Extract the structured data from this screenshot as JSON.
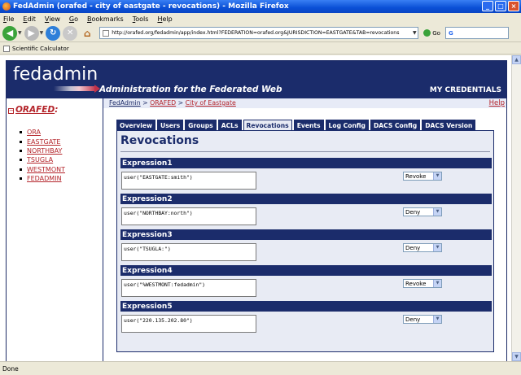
{
  "window": {
    "title": "FedAdmin (orafed - city of eastgate - revocations) - Mozilla Firefox",
    "controls": [
      "_",
      "□",
      "×"
    ]
  },
  "menu": [
    "File",
    "Edit",
    "View",
    "Go",
    "Bookmarks",
    "Tools",
    "Help"
  ],
  "navbar": {
    "url": "http://orafed.org/fedadmin/app/index.html?FEDERATION=orafed.org&JURISDICTION=EASTGATE&TAB=revocations",
    "go_label": "Go",
    "search_value": "G"
  },
  "bookmarks": [
    {
      "label": "Scientific Calculator"
    }
  ],
  "header": {
    "logo": "fedadmin",
    "tagline": "Administration for the Federated Web",
    "credentials": "MY CREDENTIALS"
  },
  "sidebar": {
    "toggle": "−",
    "federation": "ORAFED",
    "federation_suffix": ":",
    "jurisdictions": [
      "ORA",
      "EASTGATE",
      "NORTHBAY",
      "TSUGLA",
      "WESTMONT",
      "FEDADMIN"
    ]
  },
  "breadcrumb": {
    "root": "FedAdmin",
    "sep1": " > ",
    "federation": "ORAFED",
    "sep2": " > ",
    "jurisdiction": "City of Eastgate",
    "help": "Help"
  },
  "tabs": [
    "Overview",
    "Users",
    "Groups",
    "ACLs",
    "Revocations",
    "Events",
    "Log Config",
    "DACS Config",
    "DACS Version"
  ],
  "active_tab": "Revocations",
  "panel": {
    "title": "Revocations",
    "expressions": [
      {
        "label": "Expression1",
        "value": "user(\"EASTGATE:smith\")",
        "action": "Revoke"
      },
      {
        "label": "Expression2",
        "value": "user(\"NORTHBAY:north\")",
        "action": "Deny"
      },
      {
        "label": "Expression3",
        "value": "user(\"TSUGLA:\")",
        "action": "Deny"
      },
      {
        "label": "Expression4",
        "value": "user(\"%WESTMONT:fedadmin\")",
        "action": "Revoke"
      },
      {
        "label": "Expression5",
        "value": "user(\"220.135.202.80\")",
        "action": "Deny"
      }
    ]
  },
  "status": "Done"
}
